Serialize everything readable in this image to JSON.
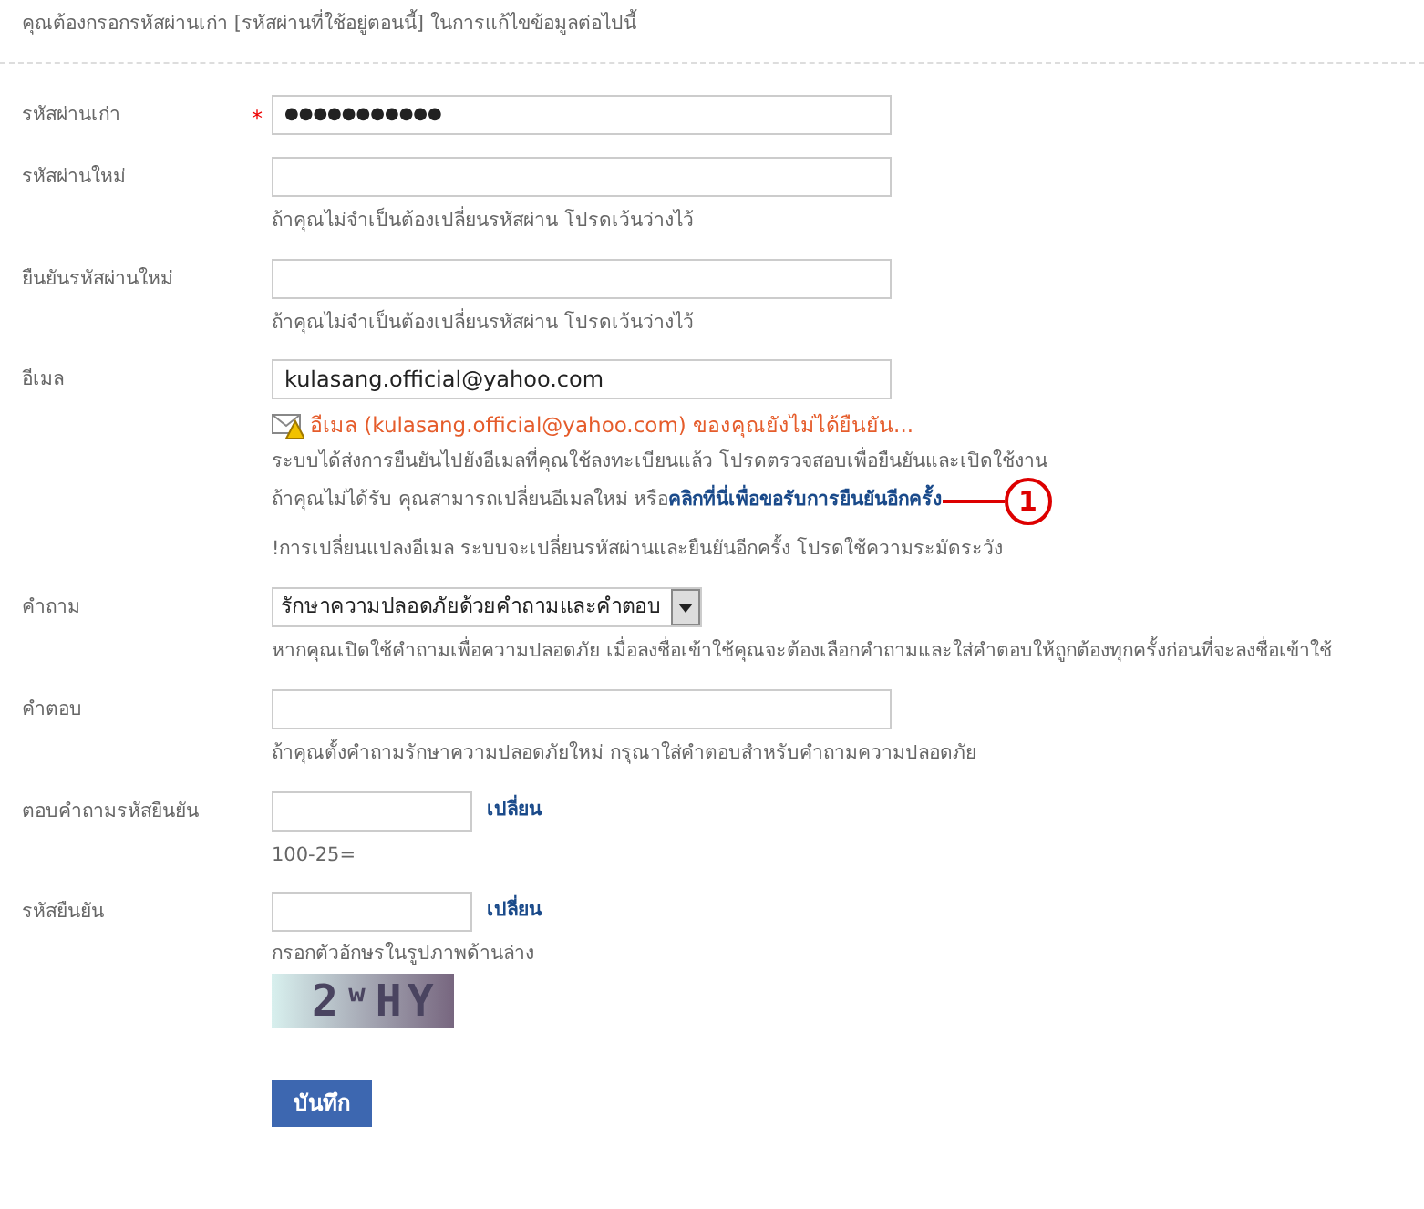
{
  "intro": "คุณต้องกรอกรหัสผ่านเก่า [รหัสผ่านที่ใช้อยู่ตอนนี้] ในการแก้ไขข้อมูลต่อไปนี้",
  "fields": [
    {
      "kind": "password",
      "label": "รหัสผ่านเก่า",
      "required_mark": "*",
      "value": "●●●●●●●●●●●"
    },
    {
      "kind": "password",
      "label": "รหัสผ่านใหม่",
      "hint": "ถ้าคุณไม่จำเป็นต้องเปลี่ยนรหัสผ่าน โปรดเว้นว่างไว้"
    },
    {
      "kind": "password",
      "label": "ยืนยันรหัสผ่านใหม่",
      "hint": "ถ้าคุณไม่จำเป็นต้องเปลี่ยนรหัสผ่าน โปรดเว้นว่างไว้"
    },
    {
      "kind": "email",
      "label": "อีเมล",
      "value": "kulasang.official@yahoo.com",
      "warning": "อีเมล (kulasang.official@yahoo.com) ของคุณยังไม่ได้ยืนยัน...",
      "notice": "ระบบได้ส่งการยืนยันไปยังอีเมลที่คุณใช้ลงทะเบียนแล้ว โปรดตรวจสอบเพื่อยืนยันและเปิดใช้งาน",
      "resend_text": "ถ้าคุณไม่ได้รับ คุณสามารถเปลี่ยนอีเมลใหม่ หรือ",
      "resend_link": "คลิกที่นี่เพื่อขอรับการยืนยันอีกครั้ง",
      "callout": "1",
      "caution": "!การเปลี่ยนแปลงอีเมล ระบบจะเปลี่ยนรหัสผ่านและยืนยันอีกครั้ง โปรดใช้ความระมัดระวัง"
    },
    {
      "kind": "select",
      "label": "คำถาม",
      "value": "รักษาความปลอดภัยด้วยคำถามและคำตอบ",
      "hint": "หากคุณเปิดใช้คำถามเพื่อความปลอดภัย เมื่อลงชื่อเข้าใช้คุณจะต้องเลือกคำถามและใส่คำตอบให้ถูกต้องทุกครั้งก่อนที่จะลงชื่อเข้าใช้"
    },
    {
      "kind": "text",
      "label": "คำตอบ",
      "hint": "ถ้าคุณตั้งคำถามรักษาความปลอดภัยใหม่ กรุณาใส่คำตอบสำหรับคำถามความปลอดภัย"
    },
    {
      "kind": "short",
      "label": "ตอบคำถามรหัสยืนยัน",
      "link": "เปลี่ยน",
      "hint": "100-25="
    },
    {
      "kind": "captcha",
      "label": "รหัสยืนยัน",
      "link": "เปลี่ยน",
      "hint": "กรอกตัวอักษรในรูปภาพด้านล่าง",
      "captcha_text": "2ʷHY"
    }
  ],
  "submit": "บันทึก"
}
